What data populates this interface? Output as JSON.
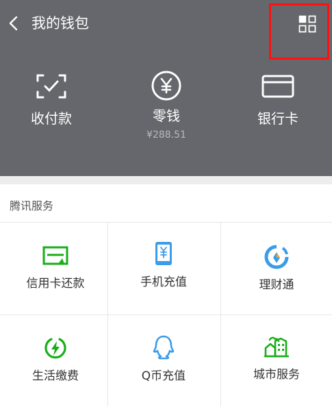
{
  "nav": {
    "title": "我的钱包",
    "back_icon": "chevron-left-icon",
    "menu_icon": "grid-icon"
  },
  "quick_actions": [
    {
      "label": "收付款",
      "icon": "scan-check-icon"
    },
    {
      "label": "零钱",
      "sub": "¥288.51",
      "icon": "yuan-coin-icon"
    },
    {
      "label": "银行卡",
      "icon": "bank-card-icon"
    }
  ],
  "section": {
    "title": "腾讯服务",
    "items": [
      {
        "label": "信用卡还款",
        "icon": "credit-card-repay-icon"
      },
      {
        "label": "手机充值",
        "icon": "phone-topup-icon"
      },
      {
        "label": "理财通",
        "icon": "wealth-icon"
      },
      {
        "label": "生活缴费",
        "icon": "utility-payment-icon"
      },
      {
        "label": "Q币充值",
        "icon": "qq-coin-icon"
      },
      {
        "label": "城市服务",
        "icon": "city-services-icon"
      }
    ]
  },
  "colors": {
    "header_bg": "#66676c",
    "green": "#1aad19",
    "blue": "#3c9ce8",
    "highlight": "#ff1010"
  }
}
